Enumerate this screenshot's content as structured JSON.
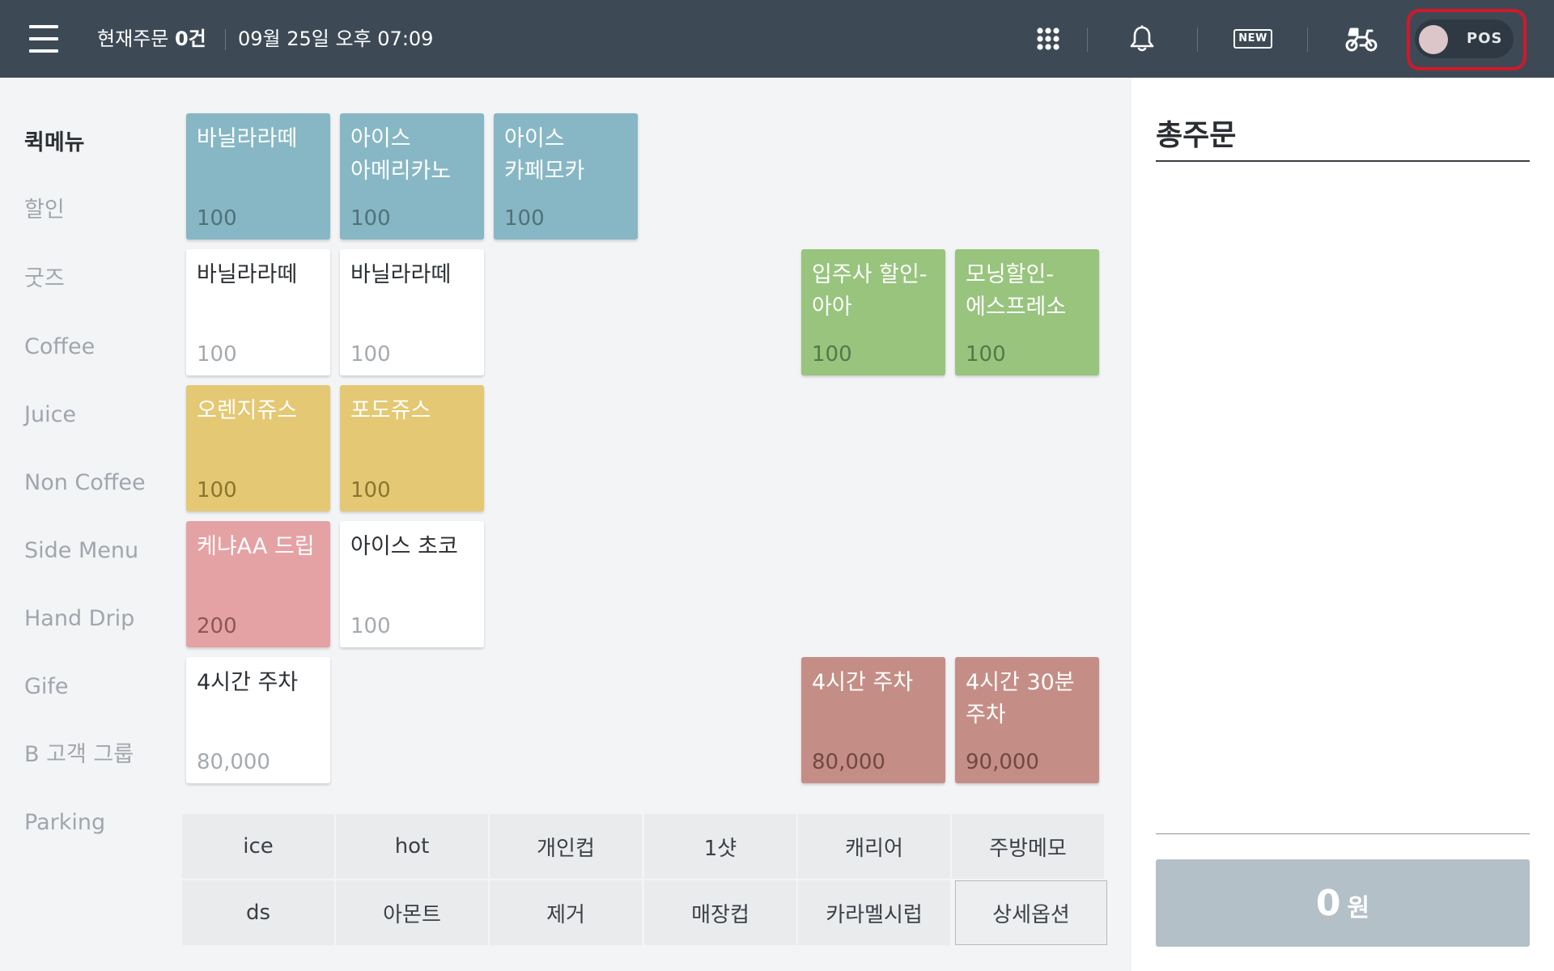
{
  "header": {
    "orders_label": "현재주문",
    "orders_count": "0건",
    "datetime": "09월 25일 오후 07:09",
    "pos_toggle_label": "POS",
    "new_badge": "NEW"
  },
  "categories": [
    {
      "label": "퀵메뉴",
      "active": true
    },
    {
      "label": "할인"
    },
    {
      "label": "굿즈"
    },
    {
      "label": "Coffee"
    },
    {
      "label": "Juice"
    },
    {
      "label": "Non Coffee"
    },
    {
      "label": "Side Menu"
    },
    {
      "label": "Hand Drip"
    },
    {
      "label": "Gife"
    },
    {
      "label": "B 고객 그룹"
    },
    {
      "label": "Parking"
    }
  ],
  "tiles": [
    {
      "name": "바닐라라떼",
      "price": "100",
      "color": "#87b7c4"
    },
    {
      "name": "아이스\n아메리카노",
      "price": "100",
      "color": "#87b7c4"
    },
    {
      "name": "아이스\n카페모카",
      "price": "100",
      "color": "#87b7c4"
    },
    {
      "name": "바닐라라떼",
      "price": "100",
      "color": "#ffffff"
    },
    {
      "name": "바닐라라떼",
      "price": "100",
      "color": "#ffffff"
    },
    {
      "name": "입주사 할인-\n아아",
      "price": "100",
      "color": "#98c47e"
    },
    {
      "name": "모닝할인-\n에스프레소",
      "price": "100",
      "color": "#98c47e"
    },
    {
      "name": "오렌지쥬스",
      "price": "100",
      "color": "#e4c873"
    },
    {
      "name": "포도쥬스",
      "price": "100",
      "color": "#e4c873"
    },
    {
      "name": "케냐AA 드립",
      "price": "200",
      "color": "#e5a2a4"
    },
    {
      "name": "아이스 초코",
      "price": "100",
      "color": "#ffffff"
    },
    {
      "name": "4시간 주차",
      "price": "80,000",
      "color": "#ffffff"
    },
    {
      "name": "4시간 주차",
      "price": "80,000",
      "color": "#c48e86"
    },
    {
      "name": "4시간 30분\n주차",
      "price": "90,000",
      "color": "#c48e86"
    }
  ],
  "options": [
    "ice",
    "hot",
    "개인컵",
    "1샷",
    "캐리어",
    "주방메모",
    "ds",
    "아몬트",
    "제거",
    "매장컵",
    "카라멜시럽",
    "상세옵션"
  ],
  "order_panel": {
    "title": "총주문",
    "total_amount": "0",
    "total_unit": "원"
  },
  "colors": {
    "header_bg": "#3d4a56",
    "pos_highlight": "#d1182a",
    "total_button": "#b4c0c8"
  }
}
